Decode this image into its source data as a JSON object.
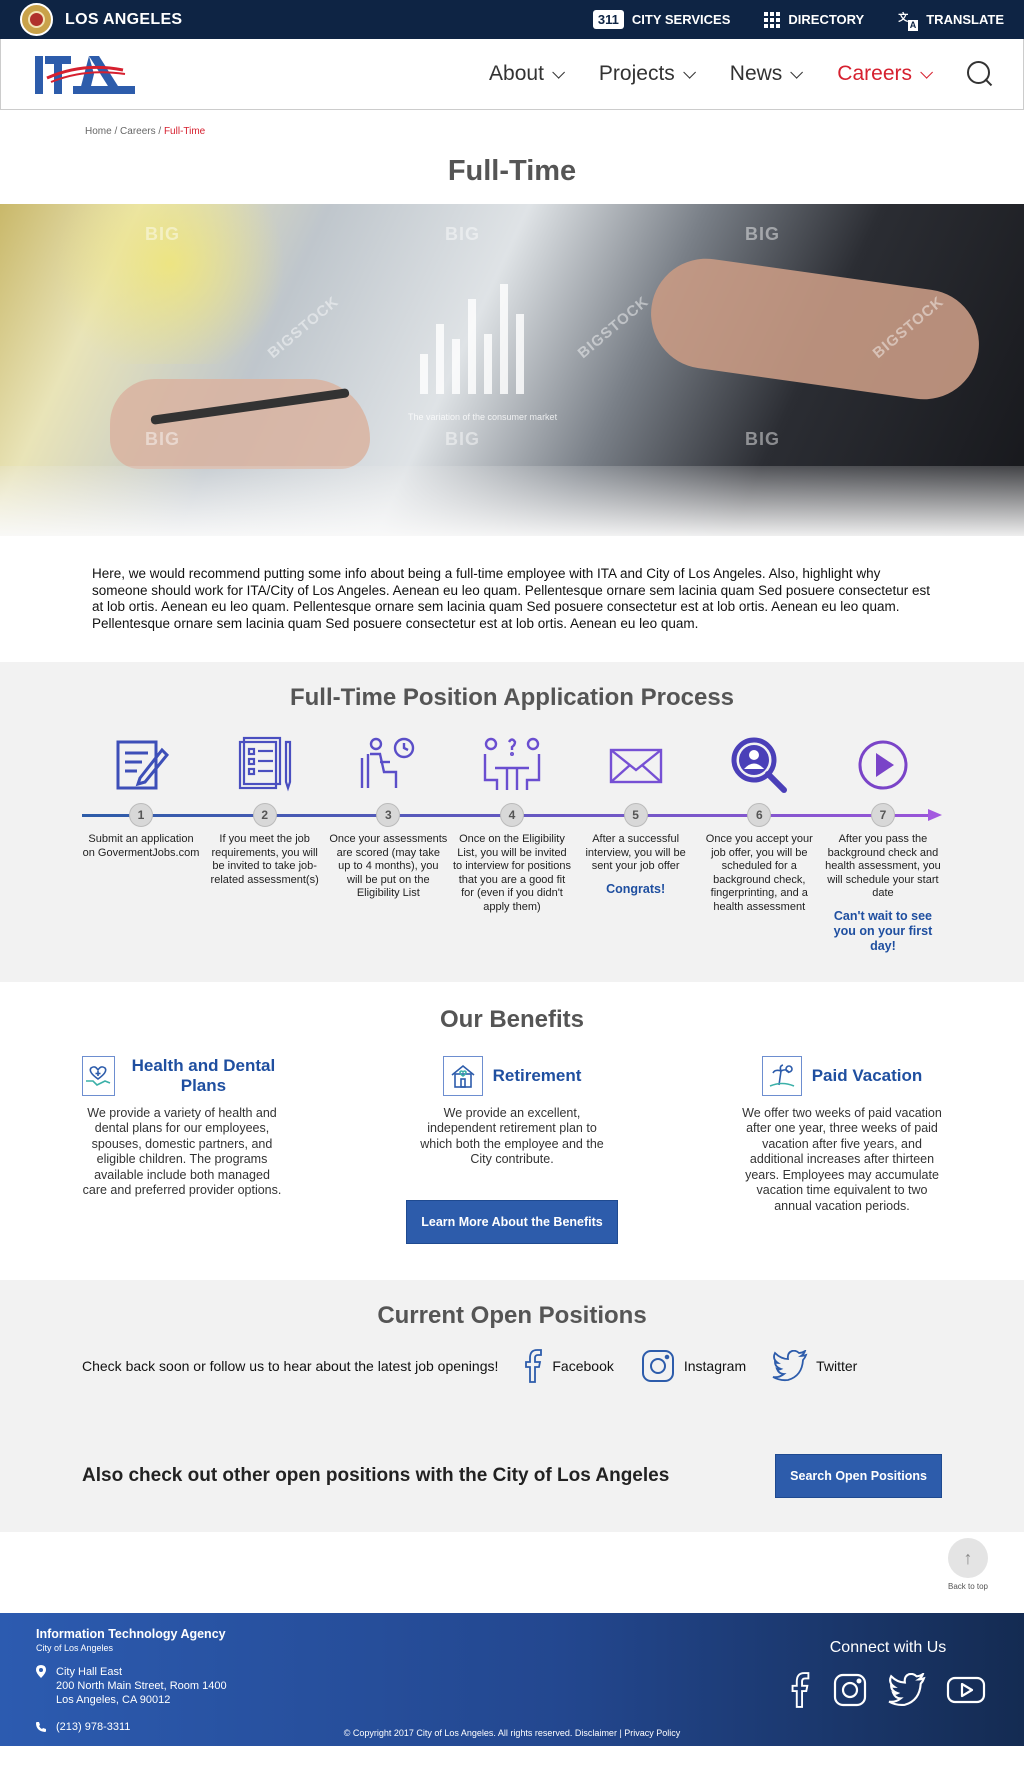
{
  "topbar": {
    "city": "LOS ANGELES",
    "badge_311": "311",
    "city_services": "CITY SERVICES",
    "directory": "DIRECTORY",
    "translate": "TRANSLATE"
  },
  "nav": {
    "logo_text": "ITA",
    "items": [
      {
        "label": "About"
      },
      {
        "label": "Projects"
      },
      {
        "label": "News"
      },
      {
        "label": "Careers"
      }
    ],
    "active_color": "#d6202f"
  },
  "breadcrumb": {
    "home": "Home",
    "sep1": " / ",
    "careers": "Careers",
    "sep2": " / ",
    "current": "Full-Time"
  },
  "page_title": "Full-Time",
  "hero": {
    "chart_caption": "The variation of the consumer market",
    "watermark_1": "BIG",
    "watermark_2": "BIGSTOCK"
  },
  "intro": "Here, we would recommend putting some info about being a full-time employee with ITA and City of Los Angeles. Also, highlight why someone should work for ITA/City of Los Angeles. Aenean eu leo quam. Pellentesque ornare sem lacinia quam Sed posuere consectetur est at lob ortis. Aenean eu leo quam. Pellentesque ornare sem lacinia quam Sed posuere consectetur est at lob ortis. Aenean eu leo quam. Pellentesque ornare sem lacinia quam Sed posuere consectetur est at lob ortis. Aenean eu leo quam.",
  "process": {
    "title": "Full-Time Position Application Process",
    "steps": [
      {
        "num": "1",
        "icon": "application-form-icon",
        "desc": "Submit an application on GovermentJobs.com",
        "emph": ""
      },
      {
        "num": "2",
        "icon": "checklist-icon",
        "desc": "If you meet the job requirements, you will be invited to take job-related assessment(s)",
        "emph": ""
      },
      {
        "num": "3",
        "icon": "person-waiting-clock-icon",
        "desc": "Once your assessments are scored (may take up to 4 months), you will be put on the Eligibility List",
        "emph": ""
      },
      {
        "num": "4",
        "icon": "interview-icon",
        "desc": "Once on the Eligibility List, you will be invited to interview for positions that you are a good fit for (even if you didn't apply them)",
        "emph": ""
      },
      {
        "num": "5",
        "icon": "envelope-icon",
        "desc": "After a successful interview, you will be sent your job offer",
        "emph": "Congrats!"
      },
      {
        "num": "6",
        "icon": "background-check-icon",
        "desc": "Once you accept your job offer, you will be scheduled for a background check, fingerprinting, and a health assessment",
        "emph": ""
      },
      {
        "num": "7",
        "icon": "play-icon",
        "desc": "After you pass the background check and health assessment, you will schedule your start date",
        "emph": "Can't wait to see you on your first day!"
      }
    ]
  },
  "benefits": {
    "title": "Our Benefits",
    "items": [
      {
        "icon": "health-hands-icon",
        "title": "Health and Dental Plans",
        "text": "We provide a variety of health and dental plans for our employees, spouses, domestic partners, and eligible children. The programs available include both managed care and preferred provider options."
      },
      {
        "icon": "house-icon",
        "title": "Retirement",
        "text": "We provide an excellent, independent retirement plan to which both the employee and the City contribute."
      },
      {
        "icon": "beach-icon",
        "title": "Paid Vacation",
        "text": "We offer two weeks of paid vacation after one year, three weeks of paid vacation after five years, and additional increases after thirteen years. Employees may accumulate vacation time equivalent to two annual vacation periods."
      }
    ],
    "button": "Learn More About the Benefits"
  },
  "positions": {
    "title": "Current Open Positions",
    "follow_text": "Check back soon or follow us to hear about the latest job openings!",
    "facebook": "Facebook",
    "instagram": "Instagram",
    "twitter": "Twitter",
    "also_text": "Also check out other open positions with the City of Los Angeles",
    "button": "Search Open Positions"
  },
  "back_to_top": "Back to top",
  "footer": {
    "org": "Information Technology Agency",
    "org_sub": "City of Los Angeles",
    "addr1": "City Hall East",
    "addr2": "200 North Main Street, Room 1400",
    "addr3": "Los Angeles, CA 90012",
    "phone": "(213) 978-3311",
    "connect": "Connect with Us",
    "copyright": "© Copyright 2017 City of Los Angeles. All rights reserved. Disclaimer | Privacy Policy"
  },
  "colors": {
    "navy": "#0e2444",
    "brand_blue": "#2d5cab",
    "accent_red": "#d6202f",
    "purple": "#7b4fd0"
  }
}
